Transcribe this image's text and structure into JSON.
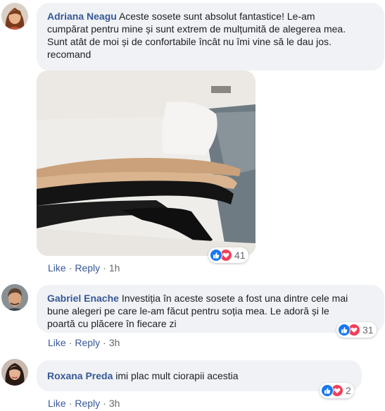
{
  "comments": [
    {
      "author": "Adriana Neagu",
      "text_first": "Aceste sosete sunt absolut fantastice! Le-am",
      "text_lines": [
        "cumpărat pentru mine și sunt extrem de mulțumită de alegerea mea.",
        "Sunt atât de moi și de confortabile încât nu îmi vine să le dau jos.",
        "recomand"
      ],
      "reaction_count": "41",
      "like_label": "Like",
      "reply_label": "Reply",
      "time": "1h",
      "avatar_colors": {
        "hair": "#7a3b1c",
        "skin": "#e8b48c",
        "bg": "#d9cfc4"
      }
    },
    {
      "author": "Gabriel Enache",
      "text_first": "Investiția în aceste sosete a fost una dintre cele mai",
      "text_lines": [
        "bune alegeri pe care le-am făcut pentru soția mea. Le adoră și le",
        "poartă cu plăcere în fiecare zi"
      ],
      "reaction_count": "31",
      "like_label": "Like",
      "reply_label": "Reply",
      "time": "3h",
      "avatar_colors": {
        "hair": "#5b4330",
        "skin": "#d9a67f",
        "bg": "#8a8f93"
      }
    },
    {
      "author": "Roxana Preda",
      "text_first": "imi plac mult ciorapii acestia",
      "text_lines": [],
      "reaction_count": "2",
      "like_label": "Like",
      "reply_label": "Reply",
      "time": "3h",
      "avatar_colors": {
        "hair": "#2a1a14",
        "skin": "#e3b394",
        "bg": "#c9b9ae"
      }
    }
  ],
  "colors": {
    "bubble": "#f0f2f5",
    "author": "#385898",
    "meta": "#65676b",
    "like": "#1877f2",
    "love": "#f33e58"
  },
  "photo": {
    "icon": "stockings-on-bed-photo"
  }
}
